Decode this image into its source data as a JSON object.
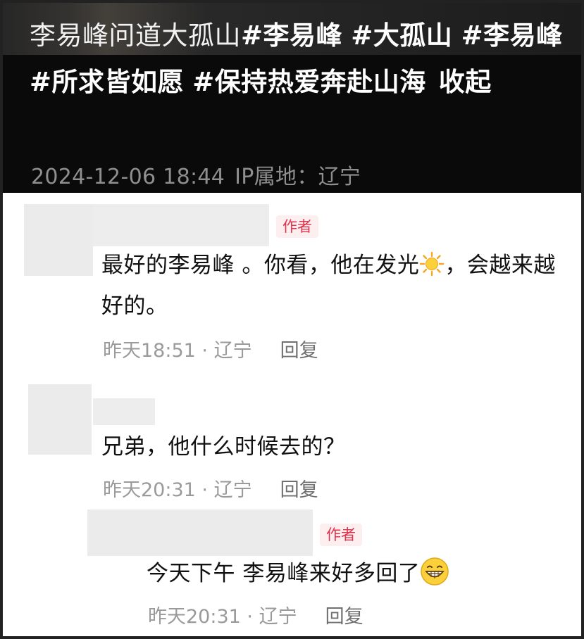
{
  "post": {
    "caption_plain": "李易峰问道大孤山",
    "tags": [
      "#李易峰",
      "#大孤山",
      "#李易峰",
      "#所求皆如愿",
      "#保持热爱奔赴山海"
    ],
    "fold_label": "收起",
    "date": "2024-12-06 18:44",
    "ip_location": "IP属地：辽宁"
  },
  "comments": [
    {
      "is_author": true,
      "badge": "作者",
      "text_before": "最好的李易峰 。你看，他在发光",
      "emoji": "sun-emoji",
      "text_after": "，会越来越好的。",
      "time": "昨天18:51",
      "location": "· 辽宁",
      "reply": "回复"
    },
    {
      "is_author": false,
      "text": "兄弟，他什么时候去的？",
      "time": "昨天20:31",
      "location": "· 辽宁",
      "reply": "回复"
    },
    {
      "is_author": true,
      "badge": "作者",
      "text_before": "今天下午 李易峰来好多回了",
      "emoji": "grinning-emoji",
      "time": "昨天20:31",
      "location": "· 辽宁",
      "reply": "回复"
    }
  ],
  "colors": {
    "header_bg": "#0a0a0a",
    "badge_text": "#e0324b",
    "badge_bg": "#fdeef0",
    "meta_text": "#9a9a9a"
  }
}
